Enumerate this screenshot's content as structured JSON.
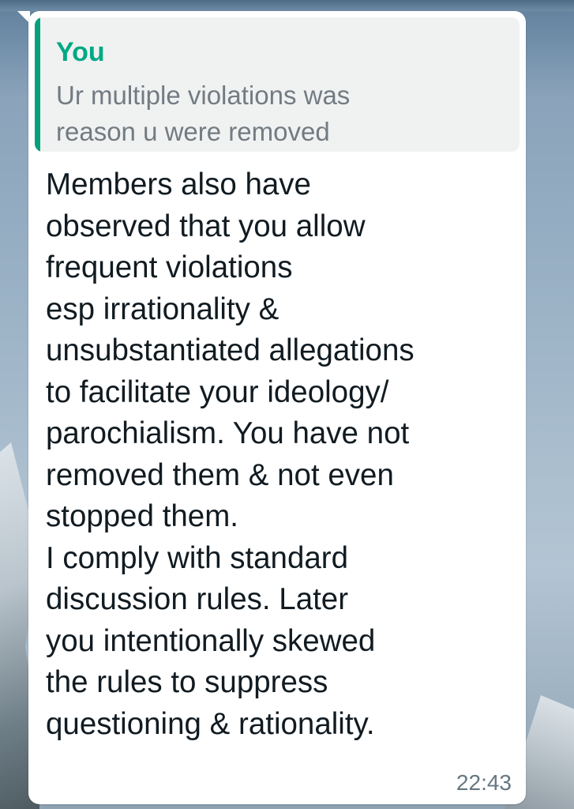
{
  "quoted_message": {
    "author": "You",
    "text": "Ur multiple violations was\nreason u were removed"
  },
  "message": {
    "text": "Members also have\nobserved that you allow\nfrequent violations\nesp irrationality &\nunsubstantiated allegations\nto facilitate your ideology/\nparochialism. You have not\nremoved them & not even\nstopped them.\nI comply with standard\ndiscussion rules. Later\nyou intentionally skewed\nthe rules to suppress\nquestioning & rationality.",
    "time": "22:43"
  },
  "colors": {
    "bubble": "#ffffff",
    "quote_background": "#f0f2f2",
    "quote_accent": "#00a884",
    "message_text": "#111b21",
    "quote_text": "#737b82",
    "timestamp": "#667781"
  }
}
